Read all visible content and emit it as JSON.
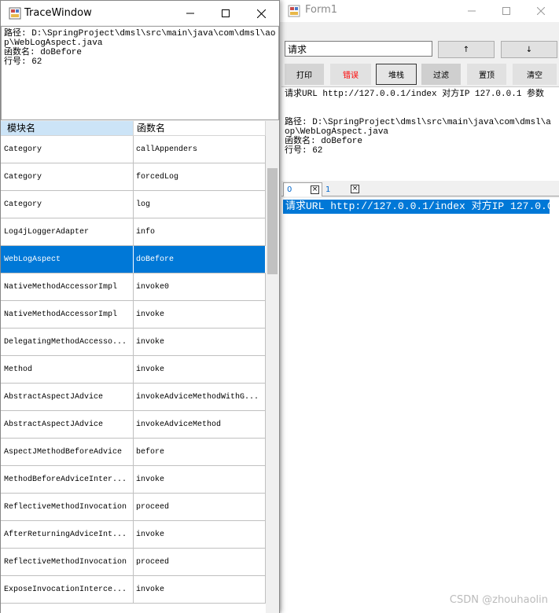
{
  "form1": {
    "title": "Form1",
    "search_value": "请求",
    "up_label": "↑",
    "down_label": "↓",
    "toolbar": {
      "print": "打印",
      "error": "错误",
      "stack": "堆栈",
      "filter": "过滤",
      "pin_top": "置顶",
      "clear": "清空"
    },
    "detail_text": "请求URL http://127.0.0.1/index 对方IP 127.0.0.1 参数\n\n\n路径: D:\\SpringProject\\dmsl\\src\\main\\java\\com\\dmsl\\aop\\WebLogAspect.java\n函数名: doBefore\n行号: 62",
    "tabs": [
      {
        "label": "0"
      },
      {
        "label": "1"
      }
    ],
    "tab_close_glyph": "×",
    "log_line": "请求URL  http://127.0.0.1/index 对方IP  127.0.0.1 参数"
  },
  "trace_window": {
    "title": "TraceWindow",
    "detail_text": "路径: D:\\SpringProject\\dmsl\\src\\main\\java\\com\\dmsl\\aop\\WebLogAspect.java\n函数名: doBefore\n行号: 62",
    "columns": [
      "模块名",
      "函数名"
    ],
    "selected_index": 4,
    "rows": [
      [
        "Category",
        "callAppenders"
      ],
      [
        "Category",
        "forcedLog"
      ],
      [
        "Category",
        "log"
      ],
      [
        "Log4jLoggerAdapter",
        "info"
      ],
      [
        "WebLogAspect",
        "doBefore"
      ],
      [
        "NativeMethodAccessorImpl",
        "invoke0"
      ],
      [
        "NativeMethodAccessorImpl",
        "invoke"
      ],
      [
        "DelegatingMethodAccesso...",
        "invoke"
      ],
      [
        "Method",
        "invoke"
      ],
      [
        "AbstractAspectJAdvice",
        "invokeAdviceMethodWithG..."
      ],
      [
        "AbstractAspectJAdvice",
        "invokeAdviceMethod"
      ],
      [
        "AspectJMethodBeforeAdvice",
        "before"
      ],
      [
        "MethodBeforeAdviceInter...",
        "invoke"
      ],
      [
        "ReflectiveMethodInvocation",
        "proceed"
      ],
      [
        "AfterReturningAdviceInt...",
        "invoke"
      ],
      [
        "ReflectiveMethodInvocation",
        "proceed"
      ],
      [
        "ExposeInvocationInterce...",
        "invoke"
      ]
    ]
  },
  "watermark": "CSDN @zhouhaolin",
  "colors": {
    "selection": "#0078d7",
    "header_selected": "#cce4f7",
    "error_text": "#ff0000"
  },
  "icons": {
    "app": "app-icon",
    "minimize": "minimize-icon",
    "maximize": "maximize-icon",
    "close": "close-icon"
  }
}
